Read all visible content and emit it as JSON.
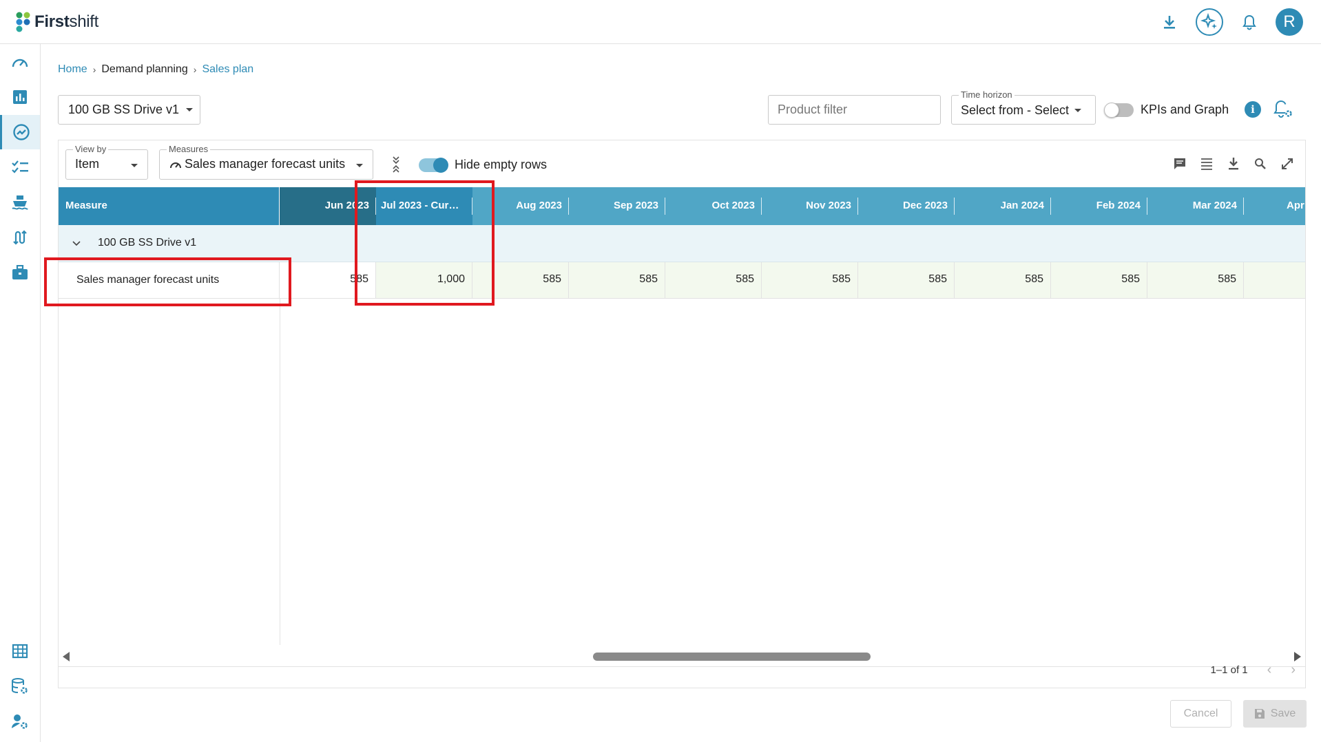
{
  "app": {
    "logo_bold": "First",
    "logo_light": "shift",
    "avatar_initial": "R"
  },
  "breadcrumb": {
    "home": "Home",
    "parent": "Demand planning",
    "current": "Sales plan",
    "separator": "›"
  },
  "plan_selector": {
    "value": "100 GB SS Drive v1"
  },
  "product_filter": {
    "placeholder": "Product filter"
  },
  "time_horizon": {
    "label": "Time horizon",
    "value": "Select from - Select"
  },
  "kpi_toggle": {
    "label": "KPIs and Graph",
    "checked": false
  },
  "view_by": {
    "label": "View by",
    "value": "Item"
  },
  "measures": {
    "label": "Measures",
    "value": "Sales manager forecast units"
  },
  "hide_empty_rows": {
    "label": "Hide empty rows",
    "checked": true
  },
  "grid": {
    "measure_header": "Measure",
    "columns": [
      "Jun 2023",
      "Jul 2023 - Cur…",
      "Aug 2023",
      "Sep 2023",
      "Oct 2023",
      "Nov 2023",
      "Dec 2023",
      "Jan 2024",
      "Feb 2024",
      "Mar 2024",
      "Apr"
    ],
    "group": {
      "label": "100 GB SS Drive v1"
    },
    "rows": [
      {
        "label": "Sales manager forecast units",
        "values": [
          "585",
          "1,000",
          "585",
          "585",
          "585",
          "585",
          "585",
          "585",
          "585",
          "585",
          ""
        ]
      }
    ]
  },
  "pagination": {
    "text": "1–1 of 1"
  },
  "buttons": {
    "cancel": "Cancel",
    "save": "Save"
  },
  "colors": {
    "accent": "#2e8bb5",
    "header": "#50a6c6",
    "past_header": "#276e88",
    "annotation": "#e0191f",
    "cell_bg": "#f3f9ee"
  }
}
